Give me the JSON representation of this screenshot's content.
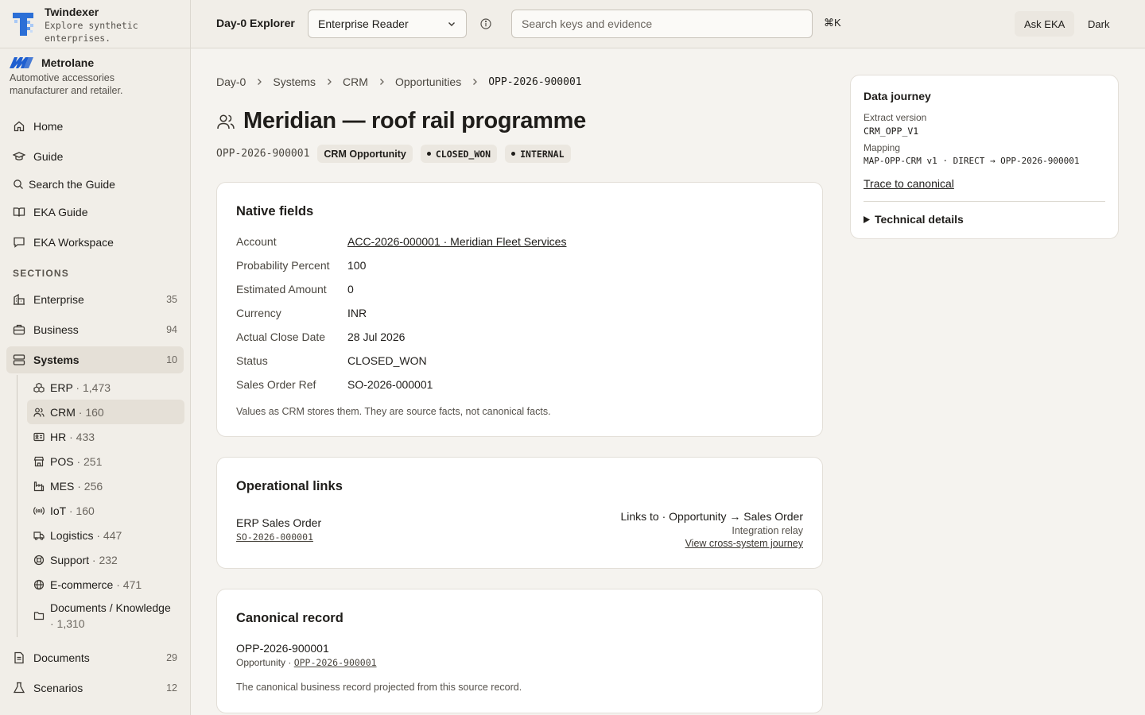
{
  "brand": {
    "title": "Twindexer",
    "subtitle_line1": "Explore synthetic",
    "subtitle_line2": "enterprises."
  },
  "org": {
    "name": "Metrolane",
    "desc_line1": "Automotive accessories",
    "desc_line2": "manufacturer and retailer."
  },
  "nav": {
    "home": "Home",
    "guide": "Guide",
    "search_guide": "Search the Guide",
    "eka_guide": "EKA Guide",
    "eka_workspace": "EKA Workspace",
    "sections_label": "SECTIONS",
    "enterprise": {
      "label": "Enterprise",
      "count": "35"
    },
    "business": {
      "label": "Business",
      "count": "94"
    },
    "systems": {
      "label": "Systems",
      "count": "10"
    },
    "documents": {
      "label": "Documents",
      "count": "29"
    },
    "scenarios": {
      "label": "Scenarios",
      "count": "12"
    }
  },
  "systems": [
    {
      "name": "ERP",
      "count": " · 1,473"
    },
    {
      "name": "CRM",
      "count": " · 160"
    },
    {
      "name": "HR",
      "count": " · 433"
    },
    {
      "name": "POS",
      "count": " · 251"
    },
    {
      "name": "MES",
      "count": " · 256"
    },
    {
      "name": "IoT",
      "count": " · 160"
    },
    {
      "name": "Logistics",
      "count": " · 447"
    },
    {
      "name": "Support",
      "count": " · 232"
    },
    {
      "name": "E-commerce",
      "count": " · 471"
    },
    {
      "name": "Documents / Knowledge",
      "count": "· 1,310"
    }
  ],
  "topbar": {
    "title": "Day-0 Explorer",
    "persona": "Enterprise Reader",
    "search_placeholder": "Search keys and evidence",
    "shortcut": "⌘K",
    "ask": "Ask EKA",
    "theme": "Dark"
  },
  "breadcrumb": [
    "Day-0",
    "Systems",
    "CRM",
    "Opportunities",
    "OPP-2026-900001"
  ],
  "record": {
    "title": "Meridian — roof rail programme",
    "id": "OPP-2026-900001",
    "type_chip": "CRM Opportunity",
    "status_chip": "CLOSED_WON",
    "visibility_chip": "INTERNAL"
  },
  "native_fields": {
    "heading": "Native fields",
    "rows": [
      {
        "label": "Account",
        "value": "ACC-2026-000001 · Meridian Fleet Services"
      },
      {
        "label": "Probability Percent",
        "value": "100"
      },
      {
        "label": "Estimated Amount",
        "value": "0"
      },
      {
        "label": "Currency",
        "value": "INR"
      },
      {
        "label": "Actual Close Date",
        "value": "28 Jul 2026"
      },
      {
        "label": "Status",
        "value": "CLOSED_WON"
      },
      {
        "label": "Sales Order Ref",
        "value": "SO-2026-000001"
      }
    ],
    "note": "Values as CRM stores them. They are source facts, not canonical facts."
  },
  "operational_links": {
    "heading": "Operational links",
    "link_type": "ERP Sales Order",
    "link_id": "SO-2026-000001",
    "relation": "Links to · Opportunity → Sales Order",
    "via": "Integration relay",
    "journey": "View cross-system journey"
  },
  "canonical": {
    "heading": "Canonical record",
    "id": "OPP-2026-900001",
    "kind": "Opportunity · ",
    "kind_link": "OPP-2026-900001",
    "note": "The canonical business record projected from this source record."
  },
  "journey": {
    "heading": "Data journey",
    "extract_label": "Extract version",
    "extract_value": "CRM_OPP_V1",
    "mapping_label": "Mapping",
    "mapping_value": "MAP-OPP-CRM v1 · DIRECT → OPP-2026-900001",
    "trace": "Trace to canonical",
    "technical": "Technical details"
  }
}
